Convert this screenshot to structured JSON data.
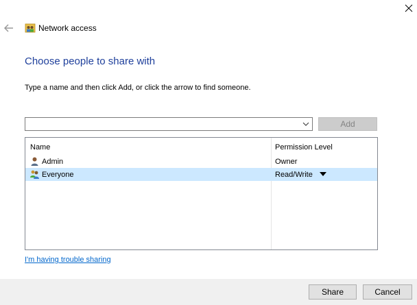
{
  "window": {
    "title": "Network access",
    "close_icon": "close-icon",
    "back_icon": "back-arrow-icon"
  },
  "main": {
    "heading": "Choose people to share with",
    "instruction": "Type a name and then click Add, or click the arrow to find someone.",
    "name_input_value": "",
    "add_label": "Add",
    "columns": [
      "Name",
      "Permission Level"
    ],
    "rows": [
      {
        "name": "Admin",
        "permission": "Owner",
        "icon": "user-icon",
        "selected": false
      },
      {
        "name": "Everyone",
        "permission": "Read/Write",
        "icon": "users-group-icon",
        "selected": true
      }
    ],
    "trouble_link": "I'm having trouble sharing"
  },
  "footer": {
    "share_label": "Share",
    "cancel_label": "Cancel"
  },
  "colors": {
    "heading": "#1e3f9b",
    "link": "#0066cc",
    "selection": "#cce8ff",
    "footer_bg": "#f0f0f0"
  }
}
